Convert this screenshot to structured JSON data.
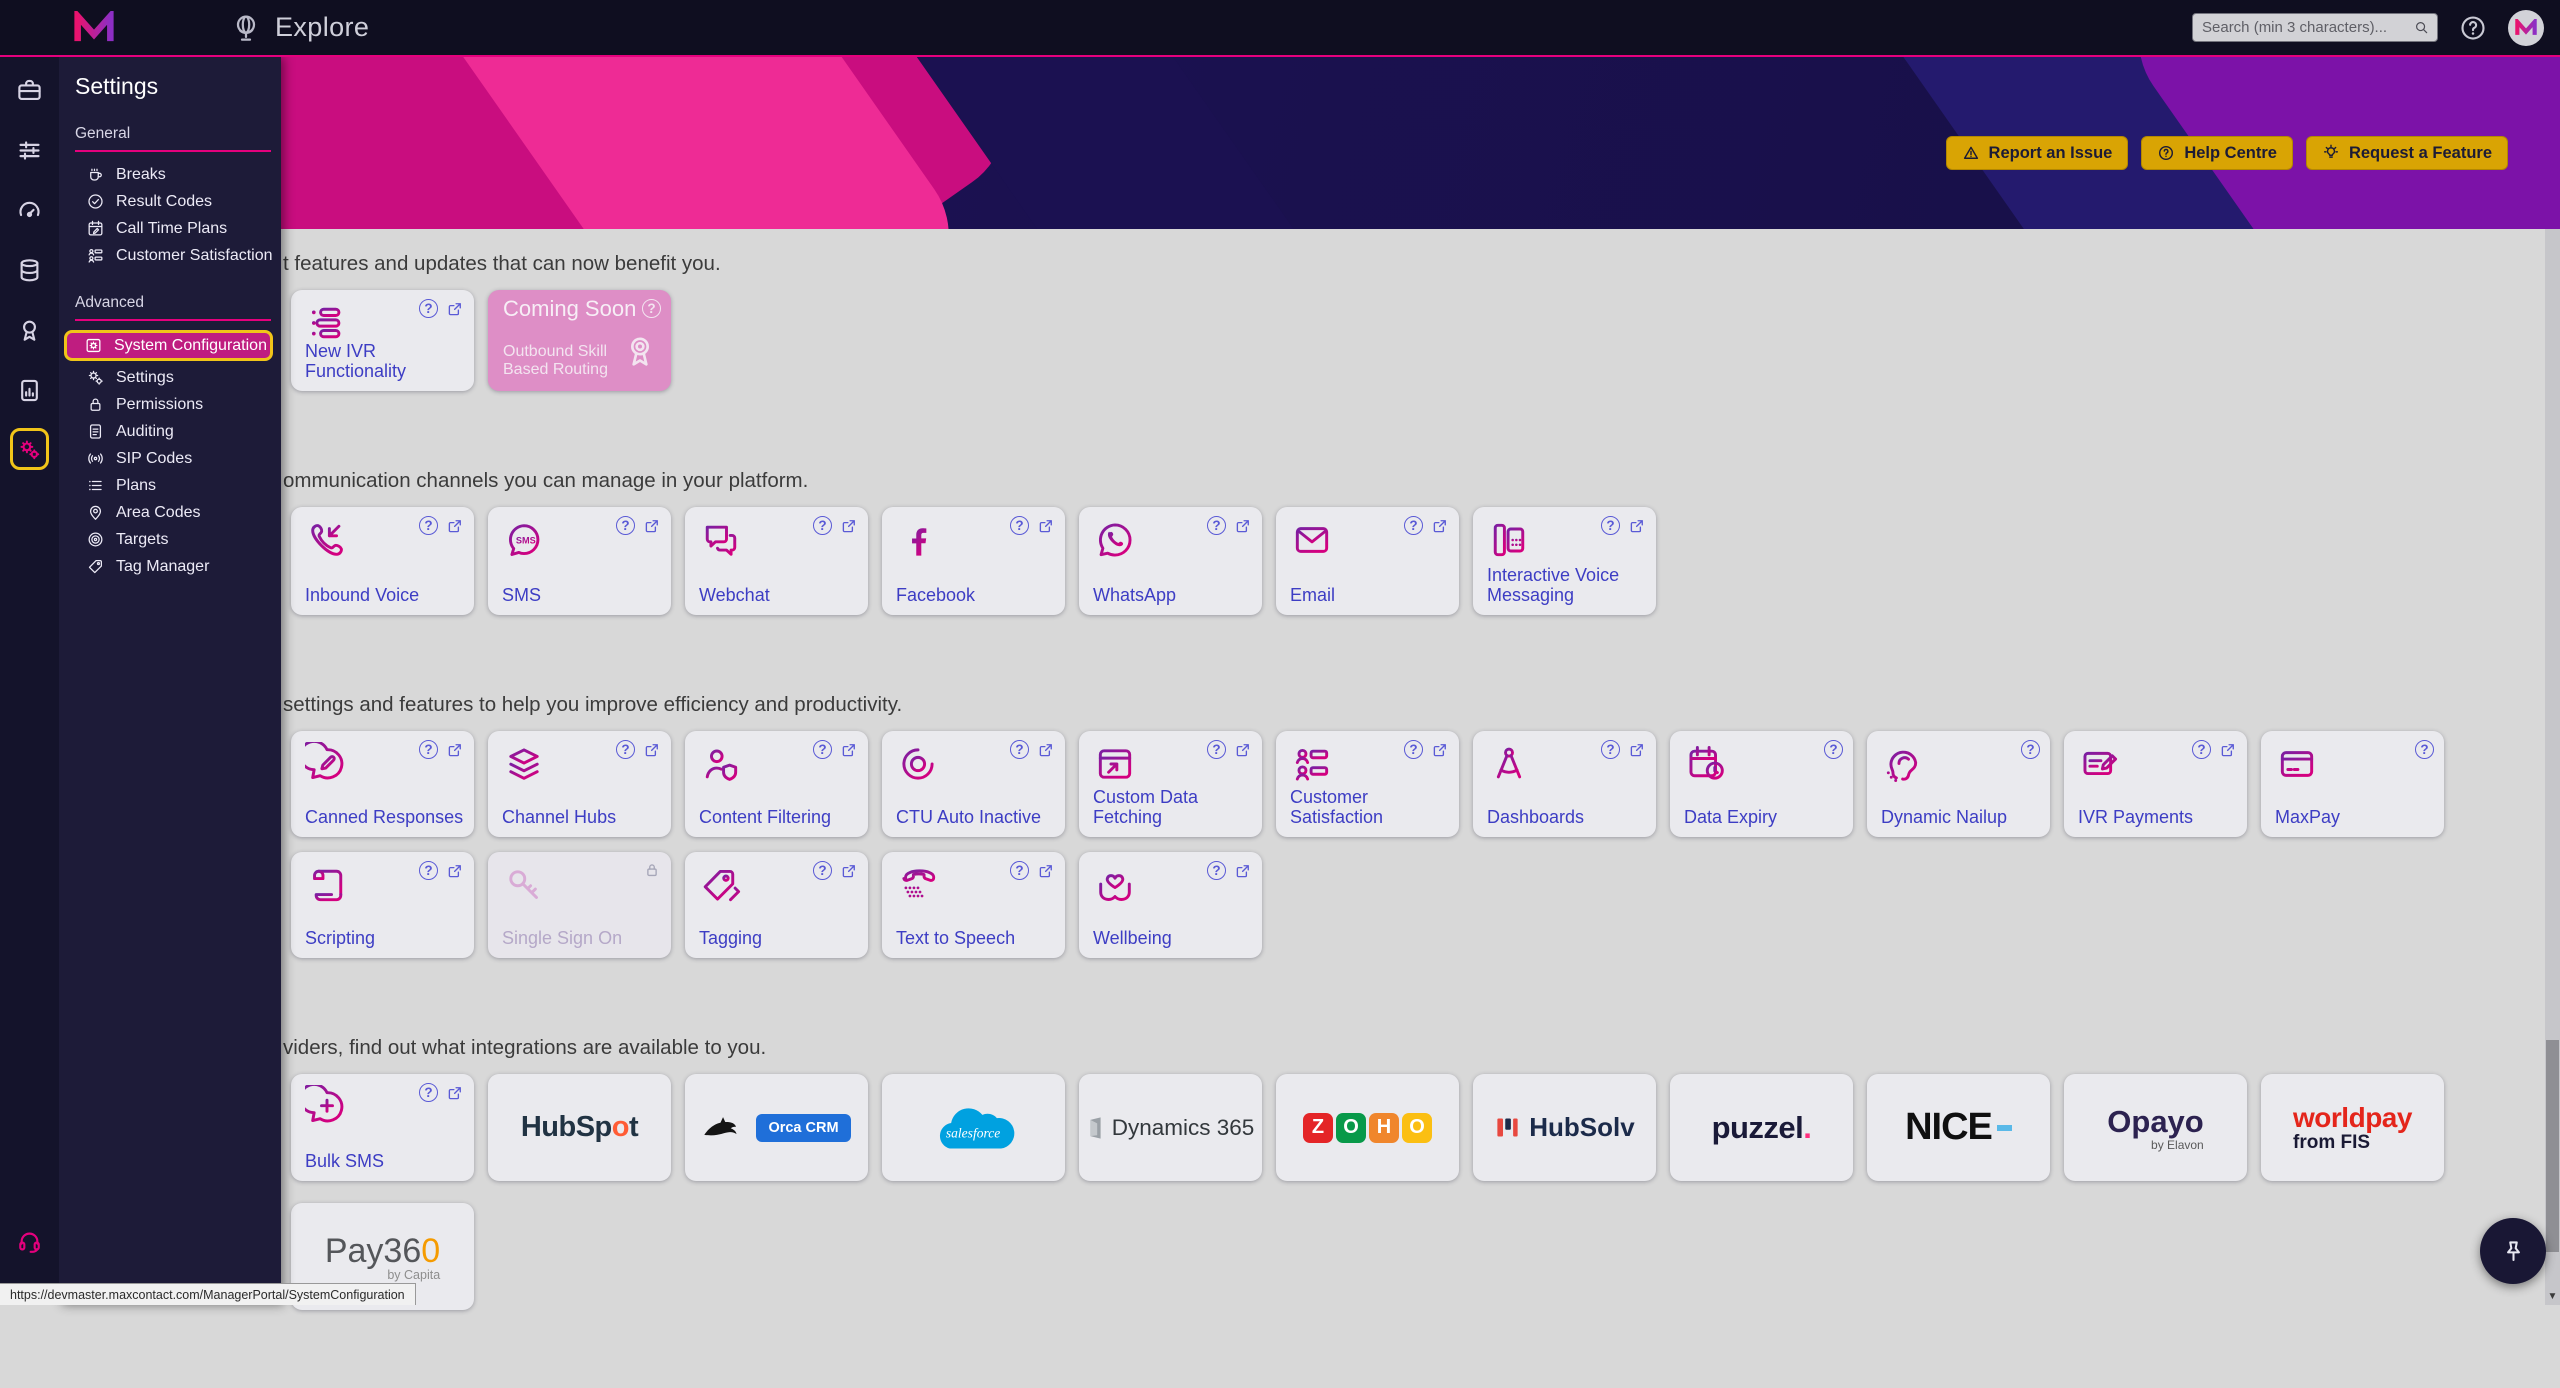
{
  "app": {
    "title": "Explore"
  },
  "topbar": {
    "search_placeholder": "Search (min 3 characters)..."
  },
  "banner": {
    "buttons": [
      {
        "label": "Report an Issue",
        "icon": "warning-triangle"
      },
      {
        "label": "Help Centre",
        "icon": "question-circle"
      },
      {
        "label": "Request a Feature",
        "icon": "lightbulb"
      }
    ]
  },
  "rail": [
    {
      "name": "toolbox",
      "icon": "briefcase"
    },
    {
      "name": "controls",
      "icon": "sliders"
    },
    {
      "name": "dashboards",
      "icon": "gauge"
    },
    {
      "name": "data",
      "icon": "database"
    },
    {
      "name": "quality",
      "icon": "ribbon"
    },
    {
      "name": "reports",
      "icon": "report"
    },
    {
      "name": "settings",
      "icon": "gear-group",
      "active": true
    },
    {
      "name": "support",
      "icon": "headset",
      "bottom": true
    }
  ],
  "settings_panel": {
    "title": "Settings",
    "sections": [
      {
        "label": "General",
        "items": [
          {
            "label": "Breaks",
            "icon": "coffee-cup"
          },
          {
            "label": "Result Codes",
            "icon": "check-circle"
          },
          {
            "label": "Call Time Plans",
            "icon": "calendar-pencil"
          },
          {
            "label": "Customer Satisfaction",
            "icon": "people-list"
          }
        ]
      },
      {
        "label": "Advanced",
        "items": [
          {
            "label": "System Configuration",
            "icon": "gear-folder",
            "active": true
          },
          {
            "label": "Settings",
            "icon": "double-gear"
          },
          {
            "label": "Permissions",
            "icon": "padlock"
          },
          {
            "label": "Auditing",
            "icon": "document-lines"
          },
          {
            "label": "SIP Codes",
            "icon": "signal"
          },
          {
            "label": "Plans",
            "icon": "list-lines"
          },
          {
            "label": "Area Codes",
            "icon": "map-pin"
          },
          {
            "label": "Targets",
            "icon": "bullseye"
          },
          {
            "label": "Tag Manager",
            "icon": "tag-simple"
          }
        ]
      }
    ]
  },
  "sections": [
    {
      "heading": "t features and updates that can now benefit you.",
      "cards": [
        {
          "label": "New IVR Functionality",
          "icon": "ivr-list",
          "actions": [
            "help",
            "open"
          ]
        },
        {
          "type": "coming-soon",
          "title": "Coming Soon",
          "label": "Outbound Skill Based Routing",
          "icon": "rosette",
          "actions": [
            "help"
          ]
        }
      ]
    },
    {
      "heading": "ommunication channels you can manage in your platform.",
      "cards": [
        {
          "label": "Inbound Voice",
          "icon": "phone-inbound",
          "actions": [
            "help",
            "open"
          ]
        },
        {
          "label": "SMS",
          "icon": "sms-bubble",
          "actions": [
            "help",
            "open"
          ]
        },
        {
          "label": "Webchat",
          "icon": "chat-bubbles",
          "actions": [
            "help",
            "open"
          ]
        },
        {
          "label": "Facebook",
          "icon": "facebook-f",
          "actions": [
            "help",
            "open"
          ]
        },
        {
          "label": "WhatsApp",
          "icon": "whatsapp",
          "actions": [
            "help",
            "open"
          ]
        },
        {
          "label": "Email",
          "icon": "envelope",
          "actions": [
            "help",
            "open"
          ]
        },
        {
          "label": "Interactive Voice Messaging",
          "icon": "desk-phone",
          "actions": [
            "help",
            "open"
          ]
        }
      ]
    },
    {
      "heading": "settings and features to help you improve efficiency and productivity.",
      "cards": [
        {
          "label": "Canned Responses",
          "icon": "bubble-pencil",
          "actions": [
            "help",
            "open"
          ]
        },
        {
          "label": "Channel Hubs",
          "icon": "layers",
          "actions": [
            "help",
            "open"
          ]
        },
        {
          "label": "Content Filtering",
          "icon": "person-shield",
          "actions": [
            "help",
            "open"
          ]
        },
        {
          "label": "CTU Auto Inactive",
          "icon": "target-rings",
          "actions": [
            "help",
            "open"
          ]
        },
        {
          "label": "Custom Data Fetching",
          "icon": "window-arrow",
          "actions": [
            "help",
            "open"
          ]
        },
        {
          "label": "Customer Satisfaction",
          "icon": "people-list",
          "actions": [
            "help",
            "open"
          ]
        },
        {
          "label": "Dashboards",
          "icon": "compass",
          "actions": [
            "help",
            "open"
          ]
        },
        {
          "label": "Data Expiry",
          "icon": "calendar-clock",
          "actions": [
            "help"
          ]
        },
        {
          "label": "Dynamic Nailup",
          "icon": "ear",
          "actions": [
            "help"
          ]
        },
        {
          "label": "IVR Payments",
          "icon": "card-pencil",
          "actions": [
            "help",
            "open"
          ]
        },
        {
          "label": "MaxPay",
          "icon": "credit-card",
          "actions": [
            "help"
          ]
        },
        {
          "label": "Scripting",
          "icon": "scroll",
          "actions": [
            "help",
            "open"
          ]
        },
        {
          "label": "Single Sign On",
          "icon": "key",
          "disabled": true,
          "actions": [
            "lock"
          ]
        },
        {
          "label": "Tagging",
          "icon": "tag-chevron",
          "actions": [
            "help",
            "open"
          ]
        },
        {
          "label": "Text to Speech",
          "icon": "phone-sound",
          "actions": [
            "help",
            "open"
          ]
        },
        {
          "label": "Wellbeing",
          "icon": "hands-heart",
          "actions": [
            "help",
            "open"
          ]
        }
      ]
    },
    {
      "heading": "viders, find out what integrations are available to you.",
      "cards": [
        {
          "label": "Bulk SMS",
          "icon": "bubble-plus",
          "actions": [
            "help",
            "open"
          ]
        },
        {
          "type": "logo",
          "logo": "hubspot",
          "label": "HubSpot"
        },
        {
          "type": "logo",
          "logo": "orca",
          "label": "Orca CRM"
        },
        {
          "type": "logo",
          "logo": "salesforce",
          "label": "salesforce"
        },
        {
          "type": "logo",
          "logo": "dynamics",
          "label": "Dynamics 365"
        },
        {
          "type": "logo",
          "logo": "zoho",
          "label": "ZOHO"
        },
        {
          "type": "logo",
          "logo": "hubsolv",
          "label": "HubSolv"
        },
        {
          "type": "logo",
          "logo": "puzzel",
          "label": "puzzel."
        },
        {
          "type": "logo",
          "logo": "nice",
          "label": "NICE"
        },
        {
          "type": "logo",
          "logo": "opayo",
          "label": "Opayo",
          "sublabel": "by Elavon"
        },
        {
          "type": "logo",
          "logo": "worldpay",
          "label": "worldpay",
          "sublabel": "from FIS"
        },
        {
          "type": "logo",
          "logo": "pay360",
          "label": "Pay360",
          "sublabel": "by Capita"
        }
      ]
    }
  ],
  "statusbar": {
    "url": "https://devmaster.maxcontact.com/ManagerPortal/SystemConfiguration"
  },
  "colors": {
    "accent_magenta": "#e5007d",
    "highlight_yellow": "#f0c419",
    "active_item_bg": "#bf1d80",
    "amber_button": "#d9a404",
    "card_label_blue": "#3d3dc4",
    "coming_soon_pink": "#de8ec6",
    "topbar_bg": "#0f0e20",
    "panel_bg": "#1d1b38"
  }
}
